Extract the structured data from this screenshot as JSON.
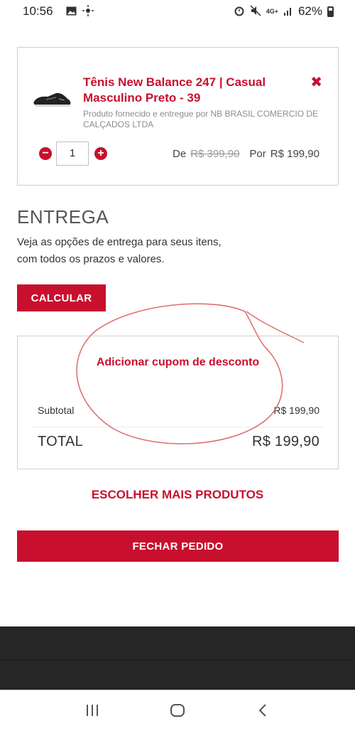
{
  "status_bar": {
    "time": "10:56",
    "battery": "62%",
    "network": "4G+",
    "icons": [
      "image-icon",
      "weather-icon",
      "alarm-icon",
      "mute-icon",
      "signal-icon",
      "battery-icon"
    ]
  },
  "product": {
    "title": "Tênis New Balance 247 | Casual Masculino Preto - 39",
    "seller": "Produto fornecido e entregue por NB BRASIL COMERCIO DE CALÇADOS LTDA",
    "quantity": "1",
    "price_from_label": "De",
    "price_old": "R$ 399,90",
    "price_by_label": "Por",
    "price_new": "R$ 199,90"
  },
  "delivery": {
    "title": "ENTREGA",
    "description": "Veja as opções de entrega para seus itens, com todos os prazos e valores.",
    "calc_button": "CALCULAR"
  },
  "summary": {
    "coupon_link": "Adicionar cupom de desconto",
    "subtotal_label": "Subtotal",
    "subtotal_value": "R$ 199,90",
    "total_label": "TOTAL",
    "total_value": "R$ 199,90"
  },
  "actions": {
    "more_products": "ESCOLHER MAIS PRODUTOS",
    "checkout": "FECHAR PEDIDO"
  },
  "colors": {
    "accent": "#c8102e",
    "annotation": "#e07070",
    "footer": "#262626"
  }
}
